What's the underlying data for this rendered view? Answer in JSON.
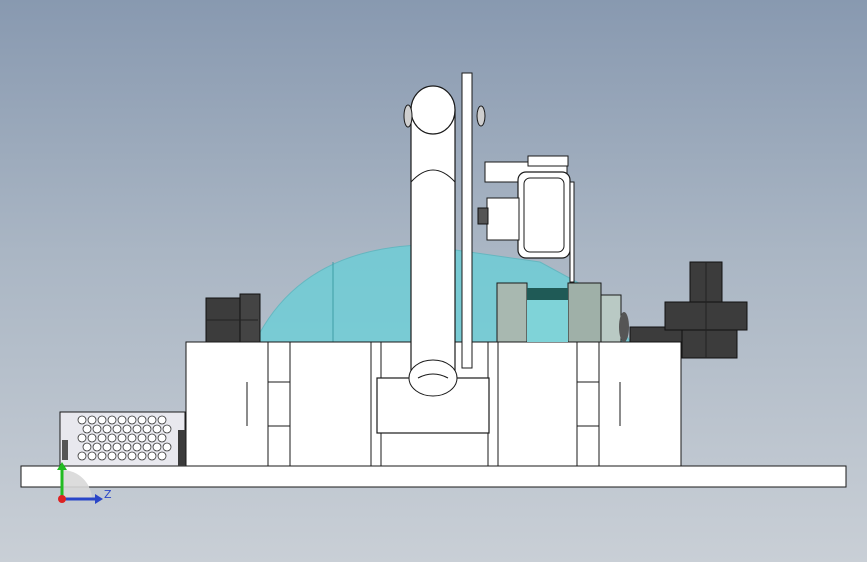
{
  "viewport": {
    "background_top": "#8899b0",
    "background_bottom": "#c9cfd6"
  },
  "triad": {
    "z_label": "Z",
    "x_color": "#2a46c8",
    "y_color": "#22bb22",
    "origin_color": "#dd2222"
  },
  "model": {
    "part_fill": "#ffffff",
    "outline": "#1a1a1a",
    "transparent_fill": "#66d0d8",
    "dark_part_fill": "#3c3c3c"
  }
}
